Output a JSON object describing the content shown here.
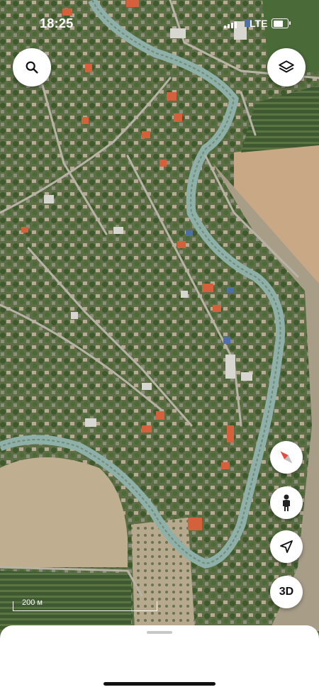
{
  "status_bar": {
    "time": "18:25",
    "network": "LTE",
    "battery_level": 0.7
  },
  "map": {
    "type": "satellite",
    "scale_label": "200 м"
  },
  "controls": {
    "search_icon": "search-icon",
    "layers_icon": "layers-icon",
    "compass_icon": "compass-icon",
    "street_view_icon": "person-icon",
    "locate_icon": "navigation-arrow-icon",
    "three_d_label": "3D"
  },
  "colors": {
    "compass_north": "#e84a3f",
    "field": "#c9a886",
    "vegetation": "#4d6a36",
    "canal": "#8fb0a8"
  }
}
